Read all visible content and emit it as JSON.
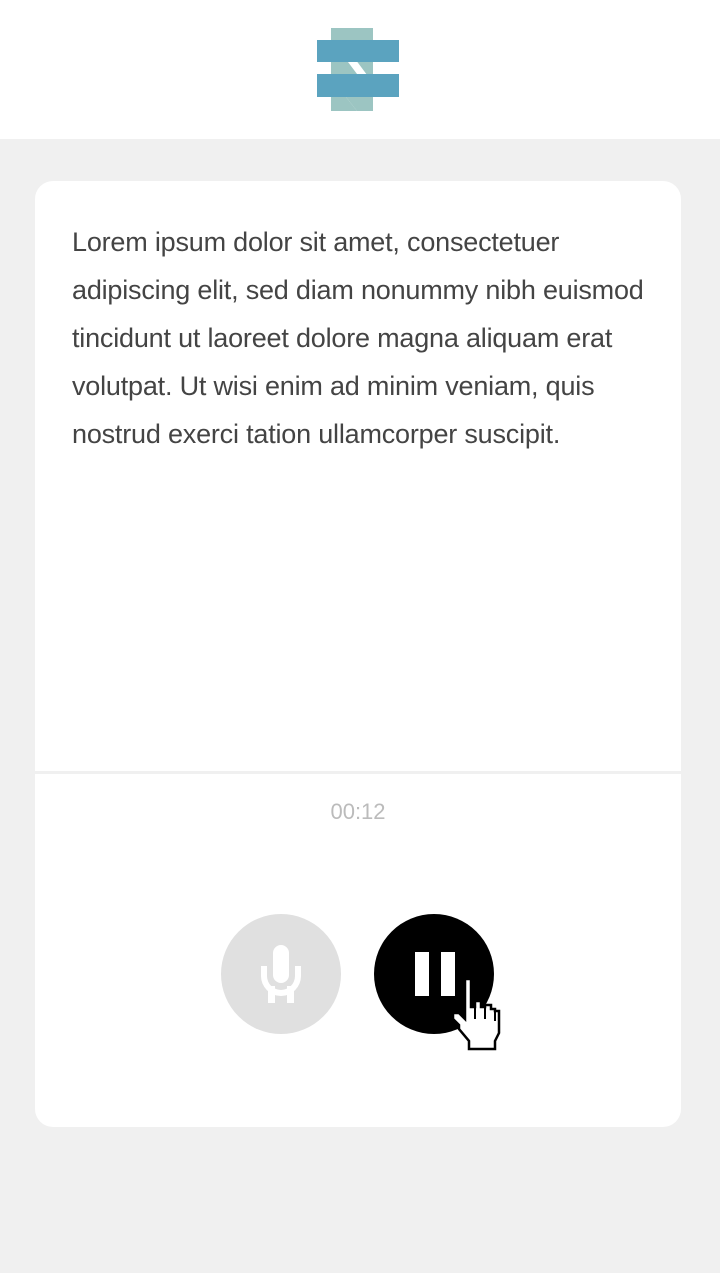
{
  "header": {
    "logo_icon": "stacked-bars-logo",
    "colors": {
      "logo_light": "#9cc5c2",
      "logo_dark": "#5ba3bf"
    }
  },
  "card": {
    "body_text": "Lorem ipsum dolor sit amet, consectetuer adipiscing elit, sed diam nonummy nibh euismod tincidunt ut laoreet dolore magna aliquam erat volutpat. Ut wisi enim ad minim veniam, quis nostrud exerci tation ullamcorper suscipit.",
    "timer": "00:12",
    "mic_button": {
      "icon": "microphone-icon",
      "state": "disabled"
    },
    "pause_button": {
      "icon": "pause-icon"
    }
  }
}
